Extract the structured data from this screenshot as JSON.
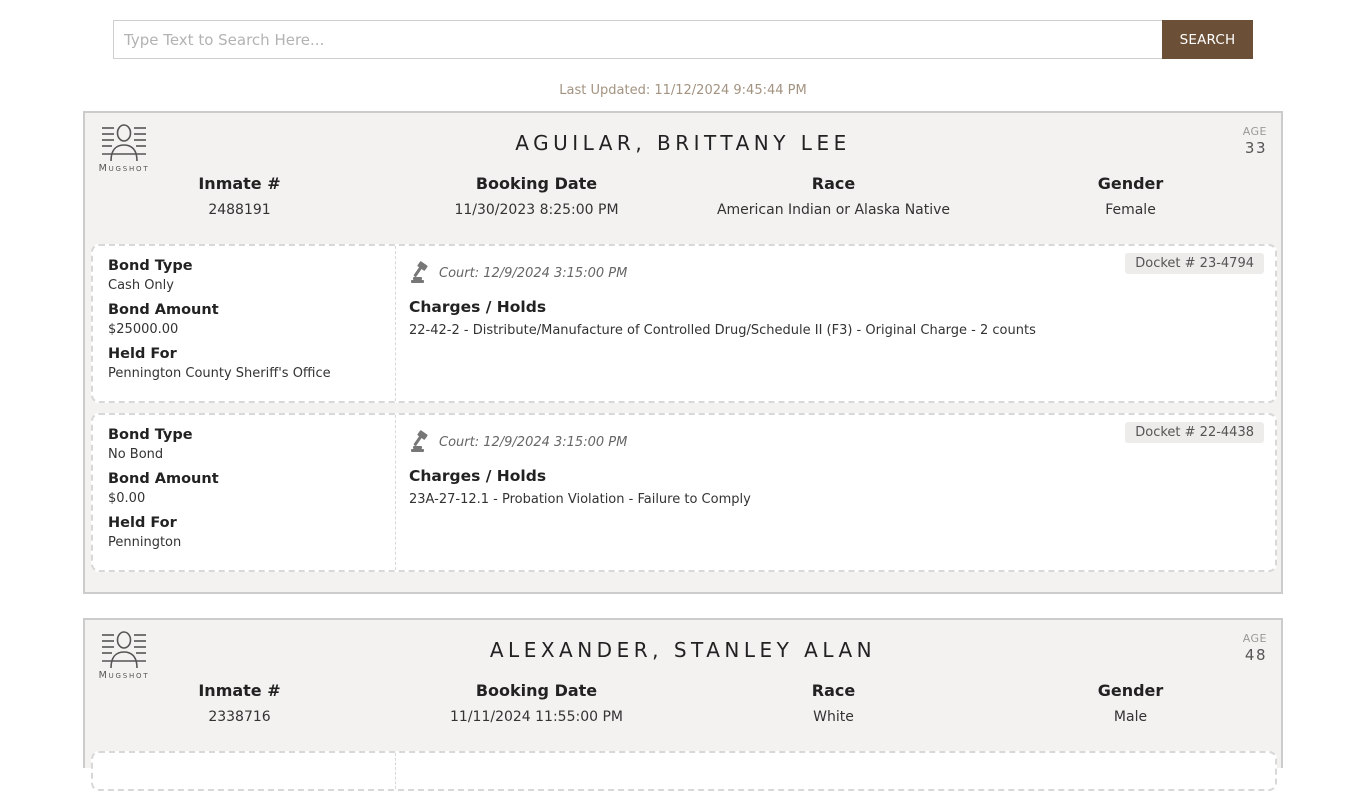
{
  "search": {
    "placeholder": "Type Text to Search Here...",
    "button_label": "SEARCH"
  },
  "last_updated": "Last Updated: 11/12/2024 9:45:44 PM",
  "labels": {
    "mugshot": "Mugshot",
    "age": "AGE",
    "inmate_no": "Inmate #",
    "booking_date": "Booking Date",
    "race": "Race",
    "gender": "Gender",
    "bond_type": "Bond Type",
    "bond_amount": "Bond Amount",
    "held_for": "Held For",
    "charges_holds": "Charges / Holds"
  },
  "inmates": [
    {
      "name": "AGUILAR, BRITTANY LEE",
      "age": "33",
      "inmate_no": "2488191",
      "booking_date": "11/30/2023 8:25:00 PM",
      "race": "American Indian or Alaska Native",
      "gender": "Female",
      "charges": [
        {
          "bond_type": "Cash Only",
          "bond_amount": "$25000.00",
          "held_for": "Pennington County Sheriff's Office",
          "court": "Court: 12/9/2024 3:15:00 PM",
          "docket": "Docket # 23-4794",
          "charge_text": "22-42-2 - Distribute/Manufacture of Controlled Drug/Schedule II (F3) - Original Charge - 2 counts"
        },
        {
          "bond_type": "No Bond",
          "bond_amount": "$0.00",
          "held_for": "Pennington",
          "court": "Court: 12/9/2024 3:15:00 PM",
          "docket": "Docket # 22-4438",
          "charge_text": "23A-27-12.1 - Probation Violation - Failure to Comply"
        }
      ]
    },
    {
      "name": "ALEXANDER, STANLEY ALAN",
      "age": "48",
      "inmate_no": "2338716",
      "booking_date": "11/11/2024 11:55:00 PM",
      "race": "White",
      "gender": "Male"
    }
  ],
  "icons": {
    "mugshot": "mugshot-icon",
    "gavel": "gavel-icon"
  },
  "colors": {
    "search_button": "#6b4f37",
    "card_bg": "#f3f2f1",
    "last_updated": "#a39381"
  }
}
